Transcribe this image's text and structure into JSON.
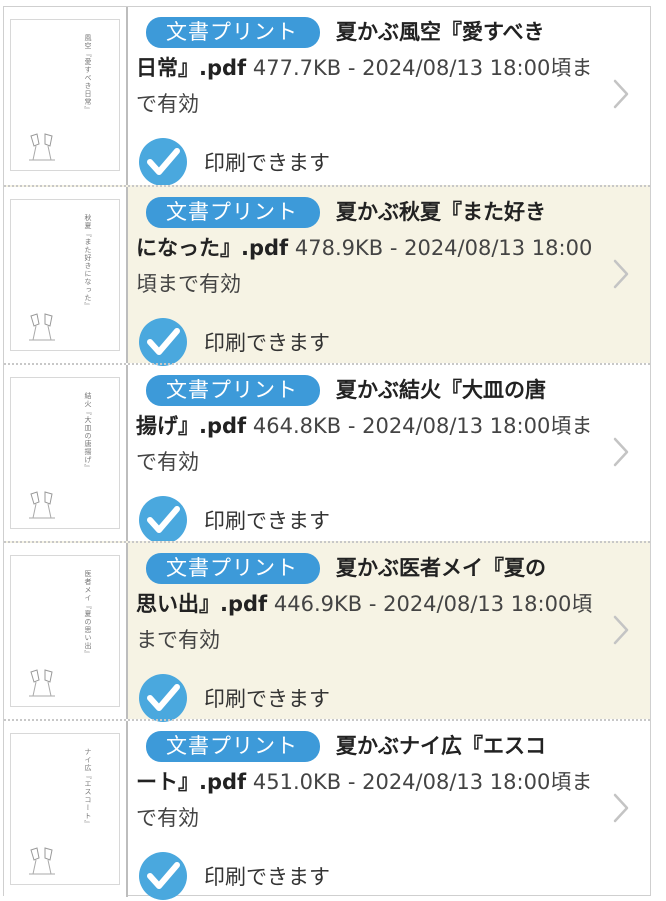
{
  "items": [
    {
      "badge": "文書プリント",
      "title_head": "夏かぶ風空『愛すべき",
      "title_tail": "日常』.pdf",
      "meta": "477.7KB - 2024/08/13 18:00頃まで有効",
      "status": "印刷できます",
      "thumb_text": "風空『愛すべき日常』",
      "shaded": false
    },
    {
      "badge": "文書プリント",
      "title_head": "夏かぶ秋夏『また好き",
      "title_tail": "になった』.pdf",
      "meta": "478.9KB - 2024/08/13 18:00頃まで有効",
      "status": "印刷できます",
      "thumb_text": "秋夏『また好きになった』",
      "shaded": true
    },
    {
      "badge": "文書プリント",
      "title_head": "夏かぶ結火『大皿の唐",
      "title_tail": "揚げ』.pdf",
      "meta": "464.8KB - 2024/08/13 18:00頃まで有効",
      "status": "印刷できます",
      "thumb_text": "結火『大皿の唐揚げ』",
      "shaded": false
    },
    {
      "badge": "文書プリント",
      "title_head": "夏かぶ医者メイ『夏の",
      "title_tail": "思い出』.pdf",
      "meta": "446.9KB - 2024/08/13 18:00頃まで有効",
      "status": "印刷できます",
      "thumb_text": "医者メイ『夏の思い出』",
      "shaded": true
    },
    {
      "badge": "文書プリント",
      "title_head": "夏かぶナイ広『エスコ",
      "title_tail": "ート』.pdf",
      "meta": "451.0KB - 2024/08/13 18:00頃まで有効",
      "status": "印刷できます",
      "thumb_text": "ナイ広『エスコート』",
      "shaded": false
    }
  ],
  "icons": {
    "status": "check-circle-icon",
    "row_action": "chevron-right-icon"
  },
  "colors": {
    "badge": "#3d9ad9",
    "check": "#4aa8de",
    "shaded_row": "#f6f3e4"
  }
}
